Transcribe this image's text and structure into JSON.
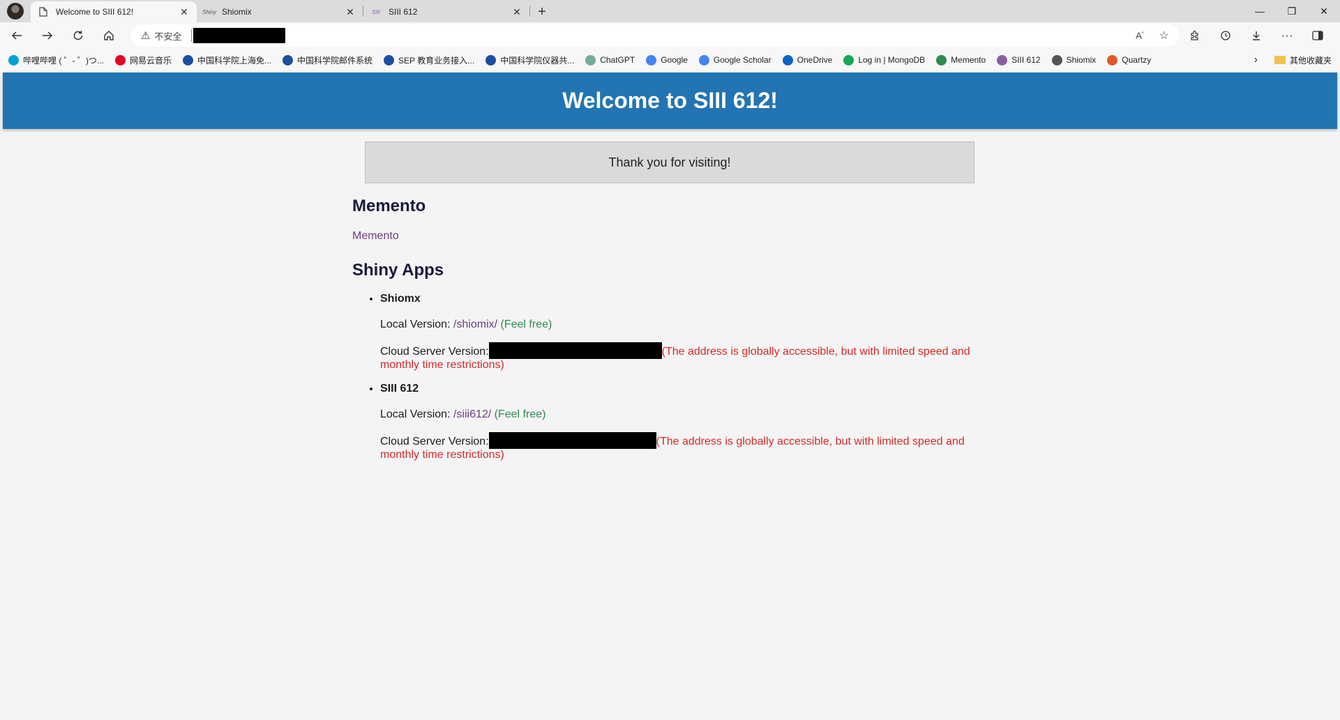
{
  "tabs": [
    {
      "title": "Welcome to SIII 612!",
      "favicon": "page-icon",
      "active": true
    },
    {
      "title": "Shiomix",
      "favicon": "shiny-icon",
      "fav_text": "Shiny",
      "active": false
    },
    {
      "title": "SIII 612",
      "favicon": "siii-icon",
      "fav_text": "SIII",
      "active": false
    }
  ],
  "address_bar": {
    "security_text": "不安全"
  },
  "bookmarks": [
    {
      "label": "哔哩哔哩 ( ゜- ゜)つ...",
      "color": "#00a1d6"
    },
    {
      "label": "网易云音乐",
      "color": "#e60026"
    },
    {
      "label": "中国科学院上海免...",
      "color": "#1a4fa0"
    },
    {
      "label": "中国科学院邮件系统",
      "color": "#1a4fa0"
    },
    {
      "label": "SEP 教育业务接入...",
      "color": "#1a4fa0"
    },
    {
      "label": "中国科学院仪器共...",
      "color": "#1a4fa0"
    },
    {
      "label": "ChatGPT",
      "color": "#74aa9c"
    },
    {
      "label": "Google",
      "color": "#4285f4"
    },
    {
      "label": "Google Scholar",
      "color": "#4285f4"
    },
    {
      "label": "OneDrive",
      "color": "#0a64c8"
    },
    {
      "label": "Log in | MongoDB",
      "color": "#13aa52"
    },
    {
      "label": "Memento",
      "color": "#2e8a4e"
    },
    {
      "label": "SIII 612",
      "color": "#8a5fa0"
    },
    {
      "label": "Shiomix",
      "color": "#555555"
    },
    {
      "label": "Quartzy",
      "color": "#e05a2a"
    }
  ],
  "bookmarks_folder": "其他收藏夹",
  "page": {
    "header_title": "Welcome to SIII 612!",
    "notice": "Thank you for visiting!",
    "memento_heading": "Memento",
    "memento_link": "Memento",
    "shiny_heading": "Shiny Apps",
    "apps": [
      {
        "name": "Shiomx",
        "local_label": "Local Version: ",
        "local_link": "/shiomix/",
        "local_note": " (Feel free)",
        "cloud_label": "Cloud Server Version:",
        "cloud_note": "(The address is globally accessible, but with limited speed and monthly time restrictions)"
      },
      {
        "name": "SIII 612",
        "local_label": "Local Version: ",
        "local_link": "/siii612/",
        "local_note": " (Feel free)",
        "cloud_label": "Cloud Server Version:",
        "cloud_note": "(The address is globally accessible, but with limited speed and monthly time restrictions)"
      }
    ]
  },
  "colors": {
    "header_bg": "#2374b2",
    "link": "#6a3f7e",
    "feel_free": "#2e8a4e",
    "warning": "#d42a2a"
  }
}
